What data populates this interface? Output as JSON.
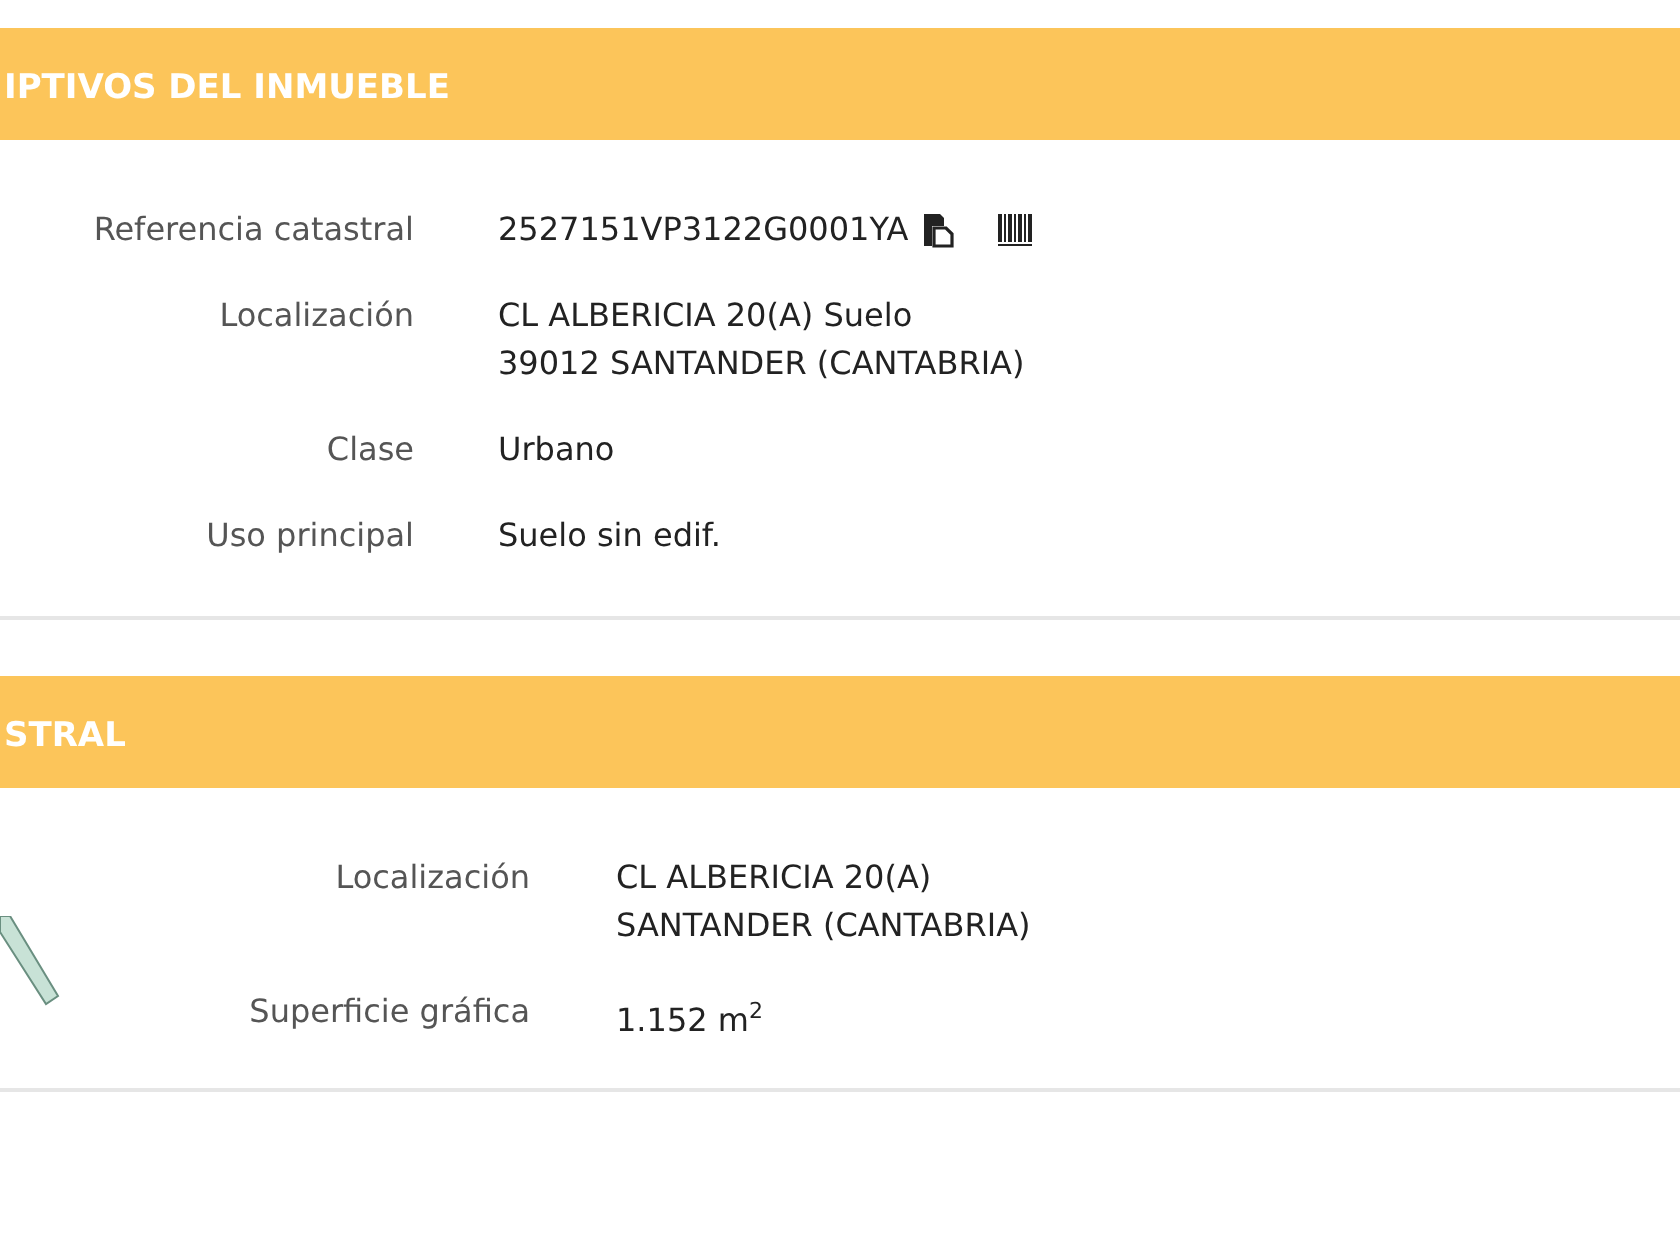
{
  "sections": [
    {
      "title": "IPTIVOS DEL INMUEBLE",
      "has_map": false,
      "rows": [
        {
          "label": "Referencia catastral",
          "lines": [
            "2527151VP3122G0001YA"
          ],
          "kind": "reference"
        },
        {
          "label": "Localización",
          "lines": [
            "CL ALBERICIA 20(A) Suelo",
            "39012 SANTANDER (CANTABRIA)"
          ],
          "kind": "text"
        },
        {
          "label": "Clase",
          "lines": [
            "Urbano"
          ],
          "kind": "text"
        },
        {
          "label": "Uso principal",
          "lines": [
            "Suelo sin edif."
          ],
          "kind": "text"
        }
      ]
    },
    {
      "title": "STRAL",
      "has_map": true,
      "rows": [
        {
          "label": "Localización",
          "lines": [
            "CL ALBERICIA 20(A)",
            "SANTANDER (CANTABRIA)"
          ],
          "kind": "text"
        },
        {
          "label": "Superficie gráfica",
          "lines": [
            "1.152 m$^{2}$"
          ],
          "kind": "text"
        }
      ]
    }
  ]
}
